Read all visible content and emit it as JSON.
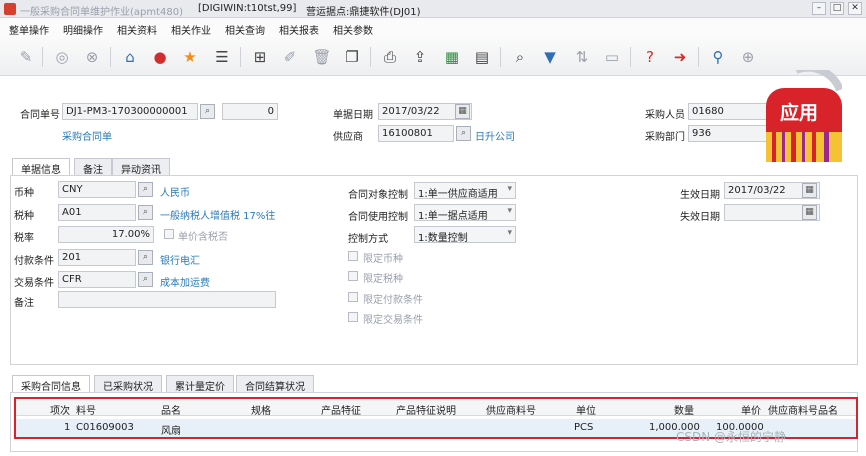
{
  "window": {
    "title": "一般采购合同单维护作业(apmt480)",
    "system": "[DIGIWIN:t10tst,99]",
    "site": "营运据点:鼎捷软件(DJ01)"
  },
  "menu": [
    "整单操作",
    "明细操作",
    "相关资料",
    "相关作业",
    "相关查询",
    "相关报表",
    "相关参数"
  ],
  "header": {
    "contract_no_label": "合同单号",
    "contract_no": "DJ1-PM3-170300000001",
    "contract_seq": "0",
    "contract_type": "采购合同单",
    "doc_date_label": "单据日期",
    "doc_date": "2017/03/22",
    "supplier_label": "供应商",
    "supplier_code": "16100801",
    "supplier_name": "日升公司",
    "buyer_label": "采购人员",
    "buyer": "01680",
    "dept_label": "采购部门",
    "dept": "936"
  },
  "badge": {
    "text": "应用"
  },
  "tabs": [
    "单据信息",
    "备注",
    "异动资讯"
  ],
  "form": {
    "currency_label": "币种",
    "currency": "CNY",
    "currency_name": "人民币",
    "tax_label": "税种",
    "tax": "A01",
    "tax_name": "一般纳税人增值税 17%往",
    "taxrate_label": "税率",
    "taxrate": "17.00%",
    "price_incl_tax": "单价含税否",
    "payment_label": "付款条件",
    "payment": "201",
    "payment_name": "银行电汇",
    "trade_label": "交易条件",
    "trade": "CFR",
    "trade_name": "成本加运费",
    "remark_label": "备注",
    "obj_ctrl_label": "合同对象控制",
    "obj_ctrl": "1:单一供应商适用",
    "use_ctrl_label": "合同使用控制",
    "use_ctrl": "1:单一据点适用",
    "ctrl_mode_label": "控制方式",
    "ctrl_mode": "1:数量控制",
    "limits": [
      "限定币种",
      "限定税种",
      "限定付款条件",
      "限定交易条件"
    ],
    "eff_date_label": "生效日期",
    "eff_date": "2017/03/22",
    "exp_date_label": "失效日期"
  },
  "bottom_tabs": [
    "采购合同信息",
    "已采购状况",
    "累计量定价",
    "合同结算状况"
  ],
  "table": {
    "columns": [
      "项次",
      "料号",
      "品名",
      "规格",
      "产品特征",
      "产品特征说明",
      "供应商料号",
      "单位",
      "数量",
      "单价",
      "供应商料号品名"
    ],
    "rows": [
      [
        "1",
        "C01609003",
        "风扇",
        "",
        "",
        "",
        "",
        "PCS",
        "1,000.000",
        "100.0000",
        ""
      ]
    ]
  },
  "watermark": "CSDN @永恒的宁静"
}
